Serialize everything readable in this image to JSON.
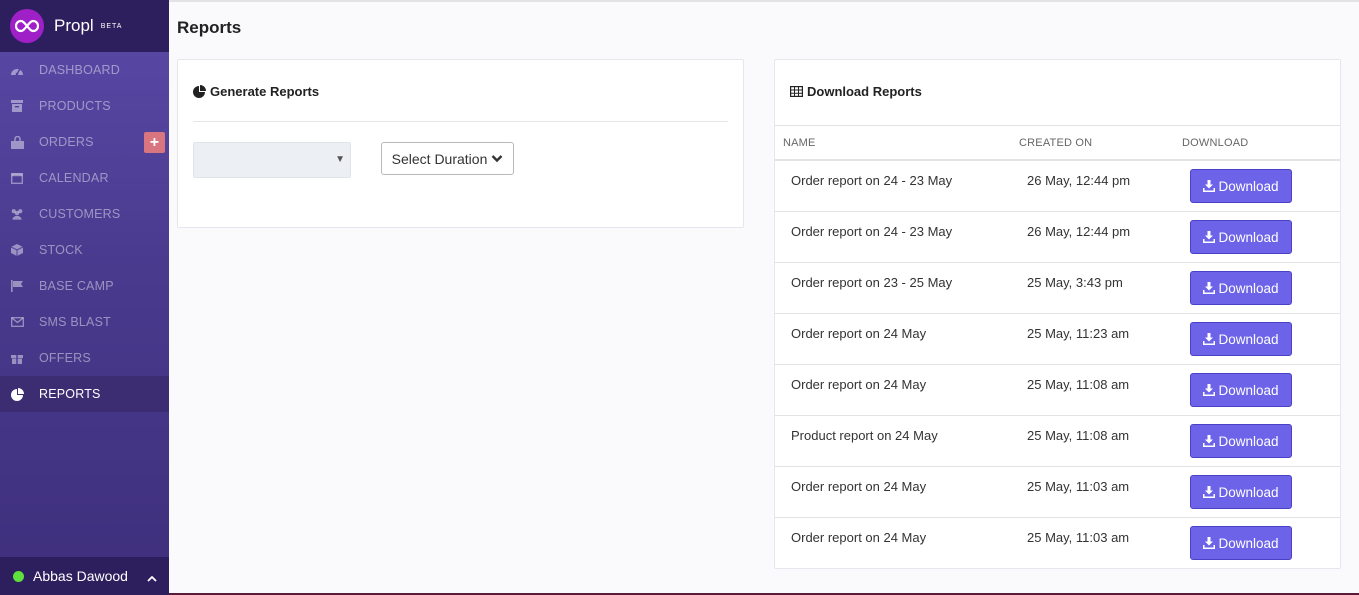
{
  "brand": {
    "name": "Propl",
    "badge": "BETA"
  },
  "sidebar": {
    "items": [
      {
        "label": "DASHBOARD",
        "icon": "dashboard-icon"
      },
      {
        "label": "PRODUCTS",
        "icon": "archive-icon"
      },
      {
        "label": "ORDERS",
        "icon": "shopping-bag-icon",
        "action": "+"
      },
      {
        "label": "CALENDAR",
        "icon": "calendar-icon"
      },
      {
        "label": "CUSTOMERS",
        "icon": "users-icon"
      },
      {
        "label": "STOCK",
        "icon": "cube-icon"
      },
      {
        "label": "BASE CAMP",
        "icon": "flag-icon"
      },
      {
        "label": "SMS BLAST",
        "icon": "envelope-icon"
      },
      {
        "label": "OFFERS",
        "icon": "gift-icon"
      },
      {
        "label": "REPORTS",
        "icon": "pie-chart-icon",
        "active": true
      }
    ],
    "user": {
      "name": "Abbas Dawood",
      "status_color": "#5fe03c"
    }
  },
  "page": {
    "title": "Reports"
  },
  "generate": {
    "title": "Generate Reports",
    "report_type_value": "",
    "duration_label": "Select Duration"
  },
  "download": {
    "title": "Download Reports",
    "columns": [
      "NAME",
      "CREATED ON",
      "DOWNLOAD"
    ],
    "button_label": "Download",
    "rows": [
      {
        "name": "Order report on 24 - 23 May",
        "created": "26 May, 12:44 pm"
      },
      {
        "name": "Order report on 24 - 23 May",
        "created": "26 May, 12:44 pm"
      },
      {
        "name": "Order report on 23 - 25 May",
        "created": "25 May, 3:43 pm"
      },
      {
        "name": "Order report on 24 May",
        "created": "25 May, 11:23 am"
      },
      {
        "name": "Order report on 24 May",
        "created": "25 May, 11:08 am"
      },
      {
        "name": "Product report on 24 May",
        "created": "25 May, 11:08 am"
      },
      {
        "name": "Order report on 24 May",
        "created": "25 May, 11:03 am"
      },
      {
        "name": "Order report on 24 May",
        "created": "25 May, 11:03 am"
      }
    ]
  },
  "colors": {
    "accent": "#6d63e8",
    "sidebar": "#4a3a8e",
    "brand": "#a020c8"
  }
}
